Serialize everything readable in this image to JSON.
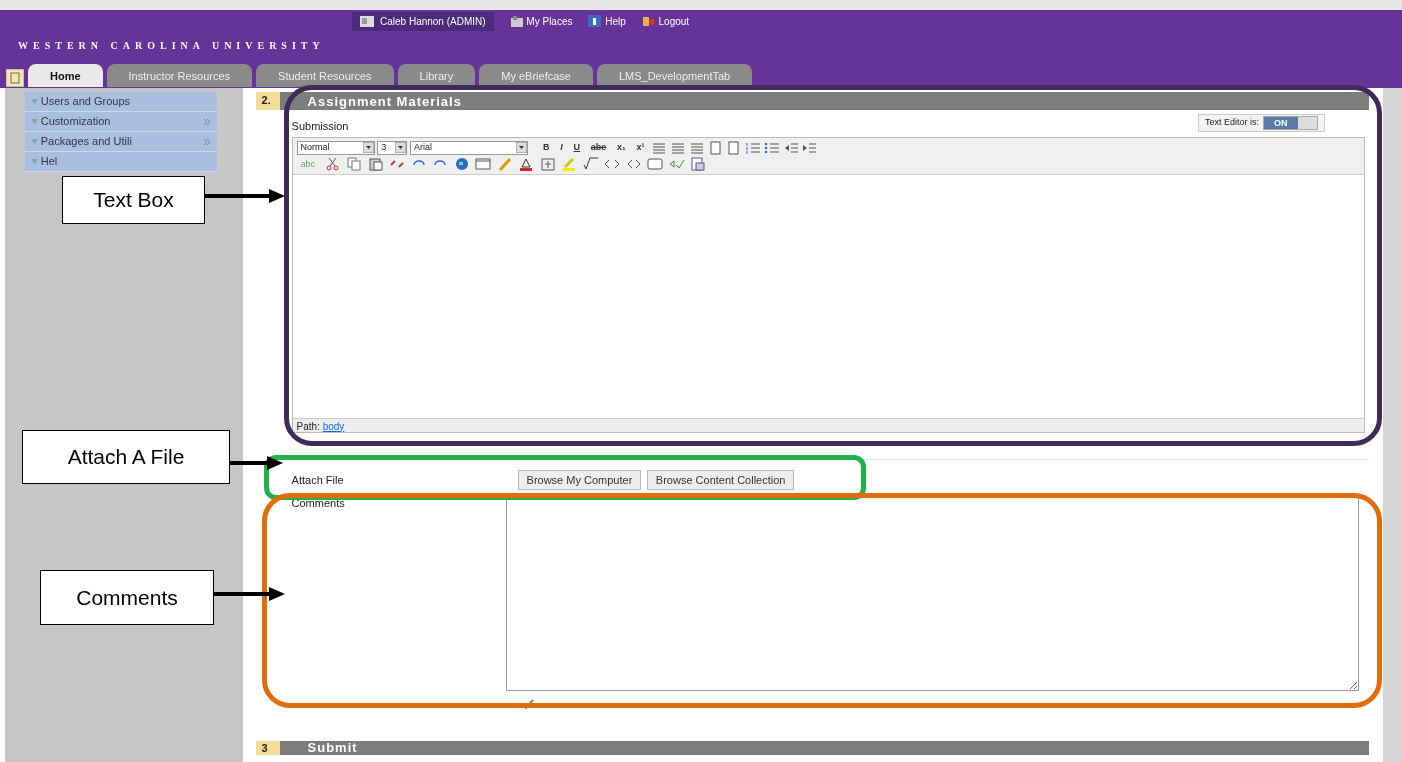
{
  "header": {
    "user": "Caleb Hannon (ADMIN)",
    "links": [
      "My Places",
      "Help",
      "Logout"
    ],
    "brand": "WESTERN CAROLINA UNIVERSITY"
  },
  "tabs": [
    {
      "label": "Home",
      "selected": true
    },
    {
      "label": "Instructor Resources",
      "selected": false
    },
    {
      "label": "Student Resources",
      "selected": false
    },
    {
      "label": "Library",
      "selected": false
    },
    {
      "label": "My eBriefcase",
      "selected": false
    },
    {
      "label": "LMS_DevelopmentTab",
      "selected": false
    }
  ],
  "sidebar": {
    "items": [
      {
        "label": "Users and Groups",
        "has_arrow": false
      },
      {
        "label": "Customization",
        "has_arrow": true
      },
      {
        "label": "Packages and Utili",
        "has_arrow": true
      },
      {
        "label": "Hel",
        "has_arrow": false
      }
    ]
  },
  "section": {
    "number": "2.",
    "title": "Assignment Materials"
  },
  "submission": {
    "label": "Submission",
    "toggle_label": "Text Editor is:",
    "toggle_text": "ON",
    "editor_on": true,
    "selects": [
      "Normal",
      "3",
      "Arial"
    ],
    "format_buttons": [
      "B",
      "I",
      "U",
      "abe",
      "x₁",
      "x¹"
    ],
    "spell_label": "abc",
    "path_label": "Path:",
    "path_link": "body"
  },
  "attach": {
    "label": "Attach File",
    "buttons": [
      "Browse My Computer",
      "Browse Content Collection"
    ]
  },
  "comments": {
    "label": "Comments"
  },
  "next_section": {
    "number": "3",
    "title": "Submit"
  },
  "annotations": [
    {
      "label": "Text Box",
      "color": "#3d2c57"
    },
    {
      "label": "Attach A File",
      "color": "#1fb24a"
    },
    {
      "label": "Comments",
      "color": "#e36c0a"
    }
  ]
}
